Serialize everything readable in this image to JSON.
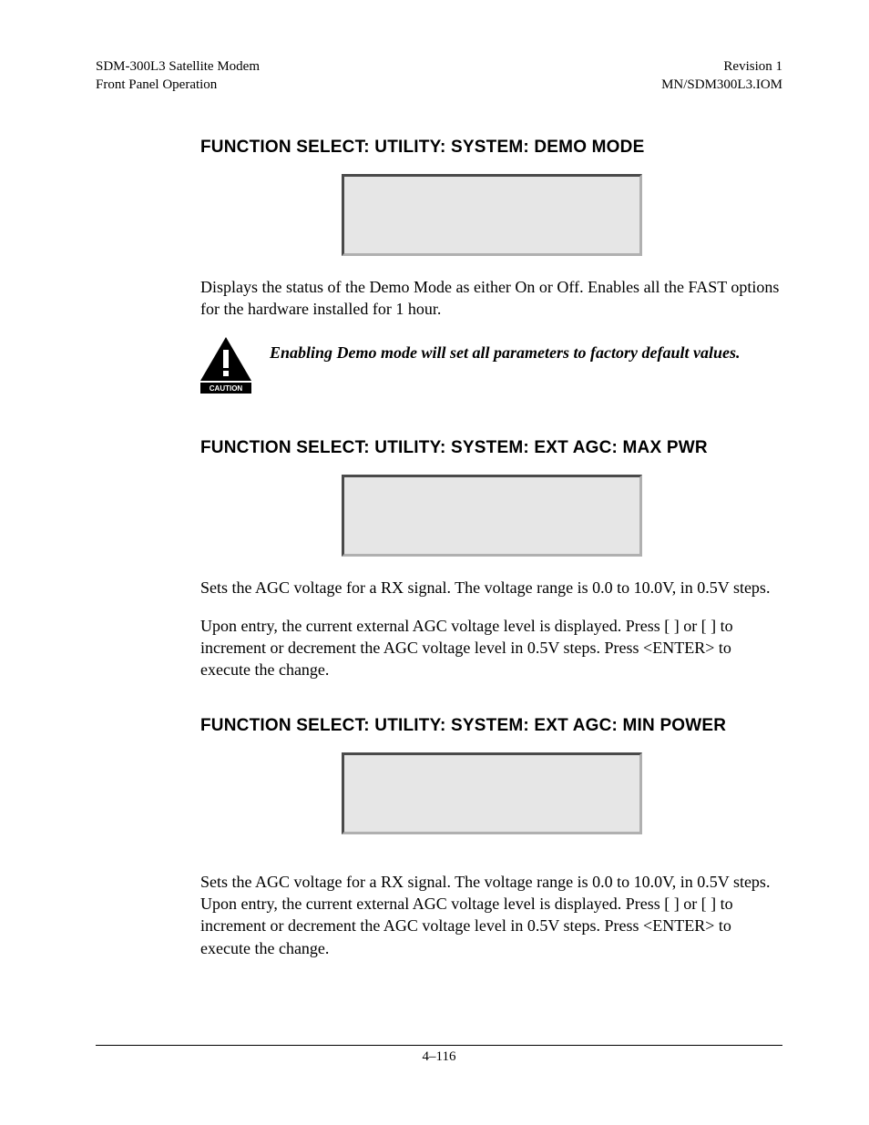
{
  "header": {
    "left_line1": "SDM-300L3 Satellite Modem",
    "left_line2": "Front Panel Operation",
    "right_line1": "Revision 1",
    "right_line2": "MN/SDM300L3.IOM"
  },
  "sections": [
    {
      "heading": "FUNCTION SELECT: UTILITY: SYSTEM: DEMO MODE",
      "paragraphs": [
        "Displays the status of the Demo Mode as either On or Off. Enables all the FAST options for the hardware installed for 1 hour."
      ],
      "caution": {
        "label": "CAUTION",
        "text": "Enabling Demo mode will set all parameters to factory default values."
      }
    },
    {
      "heading": "FUNCTION SELECT: UTILITY: SYSTEM: EXT AGC: MAX PWR",
      "paragraphs": [
        "Sets the AGC voltage for a RX signal. The voltage range is 0.0 to 10.0V, in 0.5V steps.",
        "Upon entry, the current external AGC voltage level is displayed. Press [  ] or [  ] to increment or decrement the AGC voltage level in 0.5V steps. Press <ENTER> to execute the change."
      ]
    },
    {
      "heading": "FUNCTION SELECT: UTILITY: SYSTEM: EXT AGC: MIN POWER",
      "paragraphs": [
        "Sets the AGC voltage for a RX signal. The voltage range is 0.0 to 10.0V, in 0.5V steps. Upon entry, the current external AGC voltage level is displayed. Press [  ] or [  ] to increment or decrement the AGC voltage level in 0.5V steps. Press <ENTER> to execute the change."
      ]
    }
  ],
  "footer": {
    "page_number": "4–116"
  }
}
